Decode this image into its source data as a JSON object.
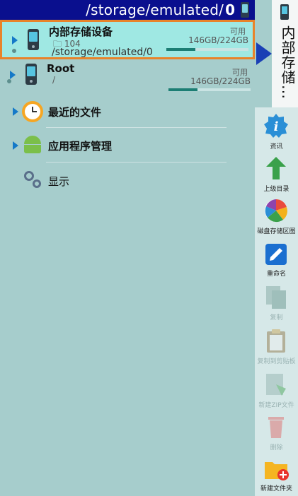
{
  "pathbar": {
    "path": "/storage/emulated/",
    "count": "0"
  },
  "tab": {
    "label": "内部存储…"
  },
  "storage": [
    {
      "title": "内部存储设备",
      "folder_count": "104",
      "path": "/storage/emulated/0",
      "avail_label": "可用",
      "capacity": "146GB/224GB",
      "used_fraction": 0.35
    },
    {
      "title": "Root",
      "path": "/",
      "avail_label": "可用",
      "capacity": "146GB/224GB",
      "used_fraction": 0.35
    }
  ],
  "nav": [
    {
      "label": "最近的文件",
      "icon": "clock-icon"
    },
    {
      "label": "应用程序管理",
      "icon": "android-icon"
    },
    {
      "label": "显示",
      "icon": "gear-icon"
    }
  ],
  "tools": [
    {
      "label": "资讯",
      "icon": "info-icon",
      "enabled": true
    },
    {
      "label": "上级目录",
      "icon": "up-arrow-icon",
      "enabled": true
    },
    {
      "label": "磁盘存储区图",
      "icon": "pie-chart-icon",
      "enabled": true
    },
    {
      "label": "重命名",
      "icon": "pencil-icon",
      "enabled": true
    },
    {
      "label": "复制",
      "icon": "copy-icon",
      "enabled": false
    },
    {
      "label": "复制到剪贴板",
      "icon": "clipboard-icon",
      "enabled": false
    },
    {
      "label": "新建ZIP文件",
      "icon": "zip-icon",
      "enabled": false
    },
    {
      "label": "删除",
      "icon": "trash-icon",
      "enabled": false
    },
    {
      "label": "新建文件夹",
      "icon": "new-folder-icon",
      "enabled": true
    }
  ],
  "colors": {
    "pathbar": "#0a0f8e",
    "selected_border": "#e8832a",
    "accent": "#1479c8",
    "list_bg": "#a6cdcc"
  }
}
